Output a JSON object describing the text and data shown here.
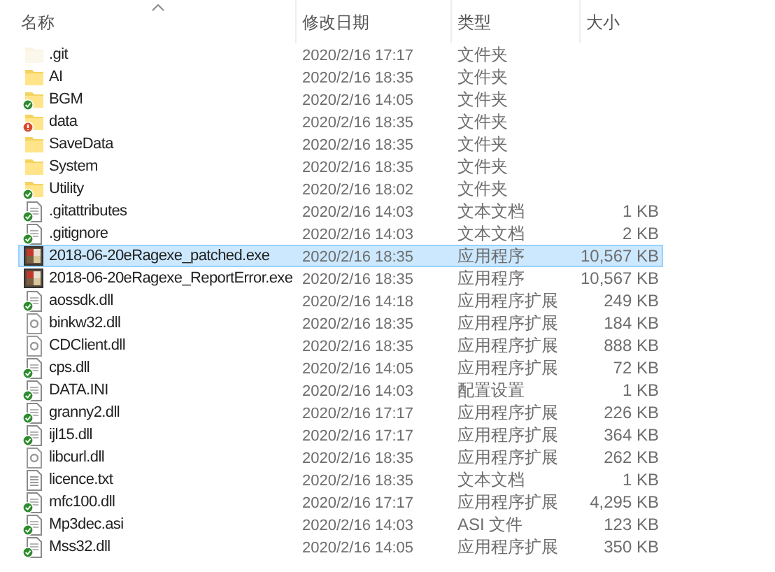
{
  "columns": [
    {
      "label": "名称",
      "sorted": true
    },
    {
      "label": "修改日期",
      "sorted": false
    },
    {
      "label": "类型",
      "sorted": false
    },
    {
      "label": "大小",
      "sorted": false
    }
  ],
  "rows": [
    {
      "name": ".git",
      "date": "2020/2/16 17:17",
      "type": "文件夹",
      "size": "",
      "kind": "folder",
      "hidden": true,
      "selected": false
    },
    {
      "name": "AI",
      "date": "2020/2/16 18:35",
      "type": "文件夹",
      "size": "",
      "kind": "folder",
      "hidden": false,
      "selected": false
    },
    {
      "name": "BGM",
      "date": "2020/2/16 14:05",
      "type": "文件夹",
      "size": "",
      "kind": "folder-synced",
      "hidden": false,
      "selected": false
    },
    {
      "name": "data",
      "date": "2020/2/16 18:35",
      "type": "文件夹",
      "size": "",
      "kind": "folder-error",
      "hidden": false,
      "selected": false
    },
    {
      "name": "SaveData",
      "date": "2020/2/16 18:35",
      "type": "文件夹",
      "size": "",
      "kind": "folder",
      "hidden": false,
      "selected": false
    },
    {
      "name": "System",
      "date": "2020/2/16 18:35",
      "type": "文件夹",
      "size": "",
      "kind": "folder",
      "hidden": false,
      "selected": false
    },
    {
      "name": "Utility",
      "date": "2020/2/16 18:02",
      "type": "文件夹",
      "size": "",
      "kind": "folder-synced",
      "hidden": false,
      "selected": false
    },
    {
      "name": ".gitattributes",
      "date": "2020/2/16 14:03",
      "type": "文本文档",
      "size": "1 KB",
      "kind": "doc-synced",
      "hidden": false,
      "selected": false
    },
    {
      "name": ".gitignore",
      "date": "2020/2/16 14:03",
      "type": "文本文档",
      "size": "2 KB",
      "kind": "doc-synced",
      "hidden": false,
      "selected": false
    },
    {
      "name": "2018-06-20eRagexe_patched.exe",
      "date": "2020/2/16 18:35",
      "type": "应用程序",
      "size": "10,567 KB",
      "kind": "exe",
      "hidden": false,
      "selected": true
    },
    {
      "name": "2018-06-20eRagexe_ReportError.exe",
      "date": "2020/2/16 18:35",
      "type": "应用程序",
      "size": "10,567 KB",
      "kind": "exe",
      "hidden": false,
      "selected": false
    },
    {
      "name": "aossdk.dll",
      "date": "2020/2/16 14:18",
      "type": "应用程序扩展",
      "size": "249 KB",
      "kind": "doc-synced",
      "hidden": false,
      "selected": false
    },
    {
      "name": "binkw32.dll",
      "date": "2020/2/16 18:35",
      "type": "应用程序扩展",
      "size": "184 KB",
      "kind": "dll",
      "hidden": false,
      "selected": false
    },
    {
      "name": "CDClient.dll",
      "date": "2020/2/16 18:35",
      "type": "应用程序扩展",
      "size": "888 KB",
      "kind": "dll",
      "hidden": false,
      "selected": false
    },
    {
      "name": "cps.dll",
      "date": "2020/2/16 14:05",
      "type": "应用程序扩展",
      "size": "72 KB",
      "kind": "doc-synced",
      "hidden": false,
      "selected": false
    },
    {
      "name": "DATA.INI",
      "date": "2020/2/16 14:03",
      "type": "配置设置",
      "size": "1 KB",
      "kind": "doc-synced",
      "hidden": false,
      "selected": false
    },
    {
      "name": "granny2.dll",
      "date": "2020/2/16 17:17",
      "type": "应用程序扩展",
      "size": "226 KB",
      "kind": "doc-synced",
      "hidden": false,
      "selected": false
    },
    {
      "name": "ijl15.dll",
      "date": "2020/2/16 17:17",
      "type": "应用程序扩展",
      "size": "364 KB",
      "kind": "doc-synced",
      "hidden": false,
      "selected": false
    },
    {
      "name": "libcurl.dll",
      "date": "2020/2/16 18:35",
      "type": "应用程序扩展",
      "size": "262 KB",
      "kind": "dll",
      "hidden": false,
      "selected": false
    },
    {
      "name": "licence.txt",
      "date": "2020/2/16 18:35",
      "type": "文本文档",
      "size": "1 KB",
      "kind": "txt",
      "hidden": false,
      "selected": false
    },
    {
      "name": "mfc100.dll",
      "date": "2020/2/16 17:17",
      "type": "应用程序扩展",
      "size": "4,295 KB",
      "kind": "doc-synced",
      "hidden": false,
      "selected": false
    },
    {
      "name": "Mp3dec.asi",
      "date": "2020/2/16 14:03",
      "type": "ASI 文件",
      "size": "123 KB",
      "kind": "doc-synced",
      "hidden": false,
      "selected": false
    },
    {
      "name": "Mss32.dll",
      "date": "2020/2/16 14:05",
      "type": "应用程序扩展",
      "size": "350 KB",
      "kind": "doc-synced",
      "hidden": false,
      "selected": false
    }
  ]
}
